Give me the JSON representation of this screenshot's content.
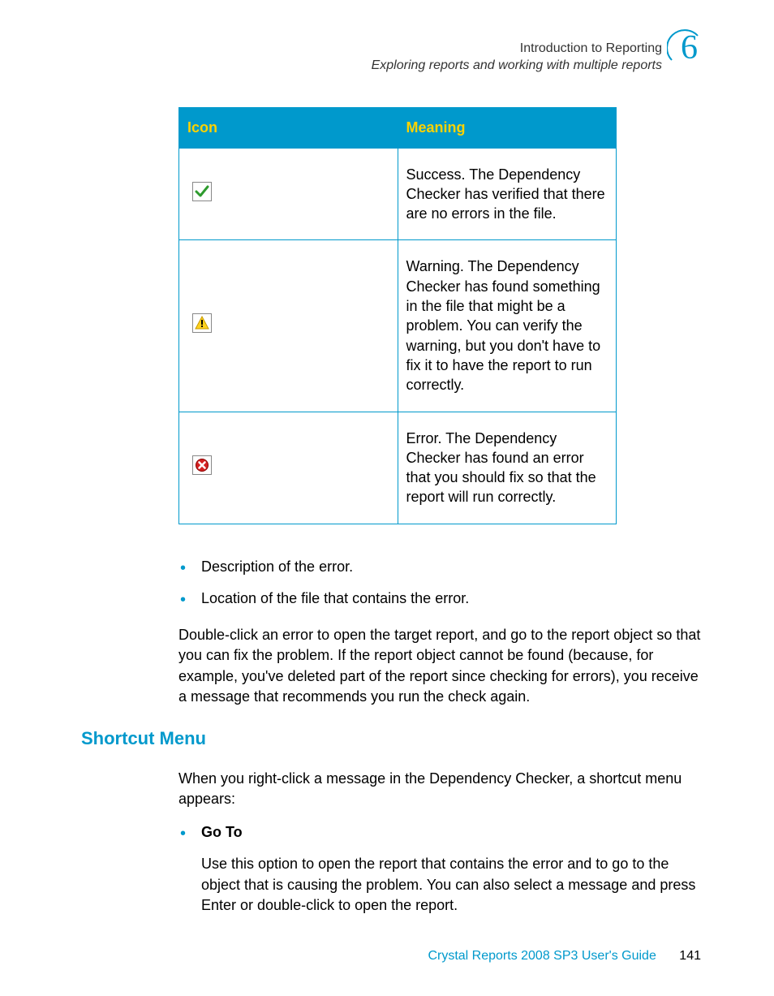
{
  "header": {
    "title": "Introduction to Reporting",
    "subtitle": "Exploring reports and working with multiple reports",
    "chapter_number": "6"
  },
  "table": {
    "headers": {
      "icon": "Icon",
      "meaning": "Meaning"
    },
    "rows": [
      {
        "icon_name": "success-icon",
        "meaning": "Success. The Dependency Checker has verified that there are no errors in the file."
      },
      {
        "icon_name": "warning-icon",
        "meaning": "Warning. The Dependency Checker has found something in the file that might be a problem. You can verify the warning, but you don't have to fix it to have the report to run correctly."
      },
      {
        "icon_name": "error-icon",
        "meaning": "Error. The Dependency Checker has found an error that you should fix so that the report will run correctly."
      }
    ]
  },
  "bullets_top": [
    "Description of the error.",
    "Location of the file that contains the error."
  ],
  "paragraph_after_table": "Double-click an error to open the target report, and go to the report object so that you can fix the problem. If the report object cannot be found (because, for example, you've deleted part of the report since checking for errors), you receive a message that recommends you run the check again.",
  "section_heading": "Shortcut Menu",
  "section_intro": "When you right-click a message in the Dependency Checker, a shortcut menu appears:",
  "menu_items": [
    {
      "label": "Go To",
      "description": "Use this option to open the report that contains the error and to go to the object that is causing the problem. You can also select a message and press Enter or double-click to open the report."
    }
  ],
  "footer": {
    "doc_title": "Crystal Reports 2008 SP3 User's Guide",
    "page_number": "141"
  }
}
